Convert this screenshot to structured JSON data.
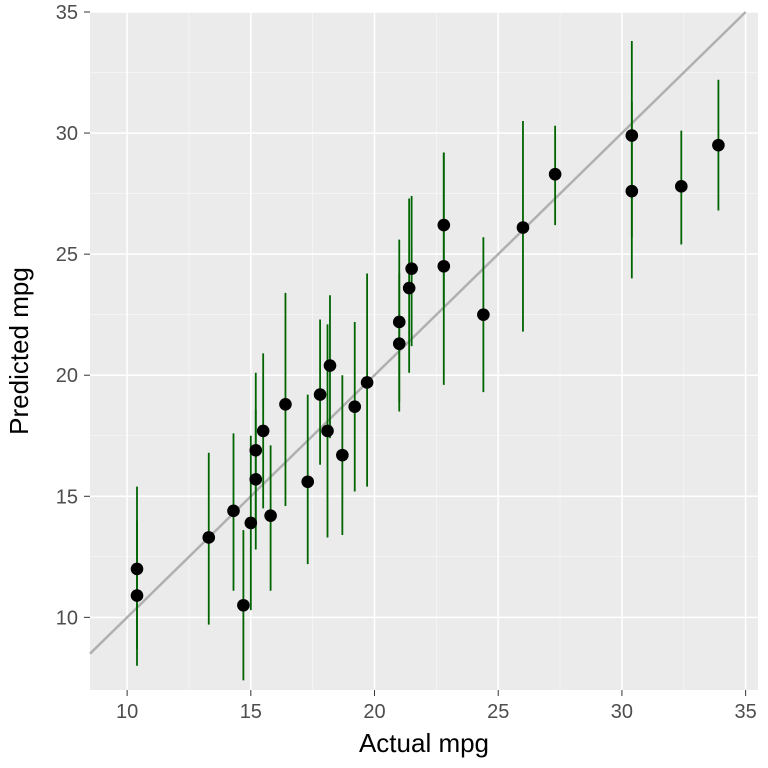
{
  "chart_data": {
    "type": "scatter",
    "title": "",
    "xlabel": "Actual mpg",
    "ylabel": "Predicted mpg",
    "xlim": [
      8.5,
      35.5
    ],
    "ylim": [
      7,
      35
    ],
    "x_ticks": [
      10,
      15,
      20,
      25,
      30,
      35
    ],
    "y_ticks": [
      10,
      15,
      20,
      25,
      30,
      35
    ],
    "abline": {
      "intercept": 0,
      "slope": 1
    },
    "error_bar_color": "#006400",
    "point_color": "#000000",
    "series": [
      {
        "name": "pred_vs_actual",
        "points": [
          {
            "x": 10.4,
            "y": 10.9,
            "ylo": 8.0,
            "yhi": 14.0
          },
          {
            "x": 10.4,
            "y": 12.0,
            "ylo": 8.7,
            "yhi": 15.4
          },
          {
            "x": 13.3,
            "y": 13.3,
            "ylo": 9.7,
            "yhi": 16.8
          },
          {
            "x": 14.3,
            "y": 14.4,
            "ylo": 11.1,
            "yhi": 17.6
          },
          {
            "x": 14.7,
            "y": 10.5,
            "ylo": 7.4,
            "yhi": 13.6
          },
          {
            "x": 15.0,
            "y": 13.9,
            "ylo": 10.3,
            "yhi": 17.5
          },
          {
            "x": 15.2,
            "y": 15.7,
            "ylo": 12.8,
            "yhi": 18.6
          },
          {
            "x": 15.2,
            "y": 16.9,
            "ylo": 13.8,
            "yhi": 20.1
          },
          {
            "x": 15.5,
            "y": 17.7,
            "ylo": 14.5,
            "yhi": 20.9
          },
          {
            "x": 15.8,
            "y": 14.2,
            "ylo": 11.1,
            "yhi": 17.1
          },
          {
            "x": 16.4,
            "y": 18.8,
            "ylo": 14.6,
            "yhi": 23.4
          },
          {
            "x": 17.3,
            "y": 15.6,
            "ylo": 12.2,
            "yhi": 19.2
          },
          {
            "x": 17.8,
            "y": 19.2,
            "ylo": 16.3,
            "yhi": 22.3
          },
          {
            "x": 18.1,
            "y": 17.7,
            "ylo": 13.3,
            "yhi": 22.1
          },
          {
            "x": 18.2,
            "y": 20.4,
            "ylo": 17.4,
            "yhi": 23.3
          },
          {
            "x": 18.7,
            "y": 16.7,
            "ylo": 13.4,
            "yhi": 20.0
          },
          {
            "x": 19.2,
            "y": 18.7,
            "ylo": 15.2,
            "yhi": 22.2
          },
          {
            "x": 19.7,
            "y": 19.7,
            "ylo": 15.4,
            "yhi": 24.2
          },
          {
            "x": 21.0,
            "y": 22.2,
            "ylo": 18.9,
            "yhi": 25.6
          },
          {
            "x": 21.0,
            "y": 21.3,
            "ylo": 18.5,
            "yhi": 24.2
          },
          {
            "x": 21.4,
            "y": 23.6,
            "ylo": 20.1,
            "yhi": 27.3
          },
          {
            "x": 21.5,
            "y": 24.4,
            "ylo": 21.2,
            "yhi": 27.4
          },
          {
            "x": 22.8,
            "y": 24.5,
            "ylo": 19.6,
            "yhi": 29.2
          },
          {
            "x": 22.8,
            "y": 26.2,
            "ylo": 22.9,
            "yhi": 29.2
          },
          {
            "x": 24.4,
            "y": 22.5,
            "ylo": 19.3,
            "yhi": 25.7
          },
          {
            "x": 26.0,
            "y": 26.1,
            "ylo": 21.8,
            "yhi": 30.5
          },
          {
            "x": 27.3,
            "y": 28.3,
            "ylo": 26.2,
            "yhi": 30.3
          },
          {
            "x": 30.4,
            "y": 29.9,
            "ylo": 25.7,
            "yhi": 33.8
          },
          {
            "x": 30.4,
            "y": 27.6,
            "ylo": 24.0,
            "yhi": 31.3
          },
          {
            "x": 32.4,
            "y": 27.8,
            "ylo": 25.4,
            "yhi": 30.1
          },
          {
            "x": 33.9,
            "y": 29.5,
            "ylo": 26.8,
            "yhi": 32.2
          }
        ]
      }
    ]
  }
}
